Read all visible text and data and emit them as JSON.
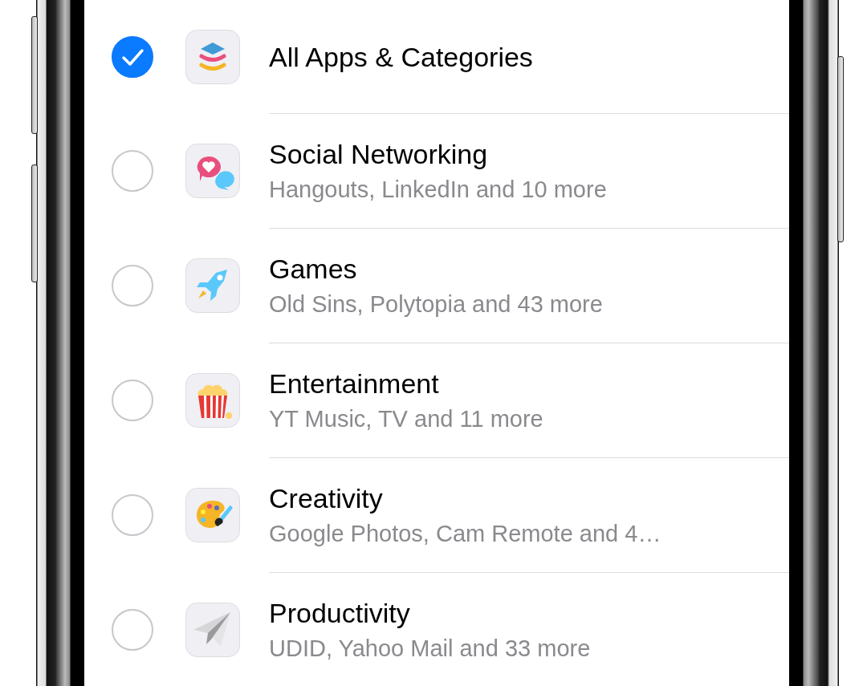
{
  "categories": [
    {
      "kind": "layers",
      "title": "All Apps & Categories",
      "selected": true
    },
    {
      "kind": "chat",
      "title": "Social Networking",
      "subtitle": "Hangouts, LinkedIn and 10 more",
      "selected": false
    },
    {
      "kind": "rocket",
      "title": "Games",
      "subtitle": "Old Sins, Polytopia and 43 more",
      "selected": false
    },
    {
      "kind": "popcorn",
      "title": "Entertainment",
      "subtitle": "YT Music, TV and 11 more",
      "selected": false
    },
    {
      "kind": "palette",
      "title": "Creativity",
      "subtitle": "Google Photos, Cam Remote and 4…",
      "selected": false
    },
    {
      "kind": "plane",
      "title": "Productivity",
      "subtitle": "UDID, Yahoo Mail and 33 more",
      "selected": false
    }
  ]
}
